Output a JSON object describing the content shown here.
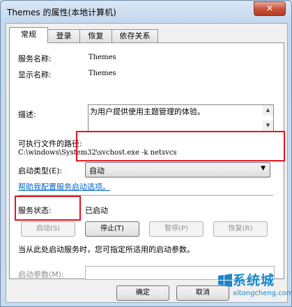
{
  "window": {
    "title": "Themes 的属性(本地计算机)",
    "close_symbol": "✕"
  },
  "tabs": [
    {
      "label": "常规",
      "active": true
    },
    {
      "label": "登录",
      "active": false
    },
    {
      "label": "恢复",
      "active": false
    },
    {
      "label": "依存关系",
      "active": false
    }
  ],
  "general": {
    "service_name_label": "服务名称:",
    "service_name": "Themes",
    "display_name_label": "显示名称:",
    "display_name": "Themes",
    "description_label": "描述:",
    "description": "为用户提供使用主题管理的体验。",
    "exe_path_label": "可执行文件的路径:",
    "exe_path": "C:\\windows\\System32\\svchost.exe -k netsvcs",
    "startup_type_label": "启动类型(E):",
    "startup_type_value": "自动",
    "help_link": "帮助我配置服务启动选项。",
    "status_label": "服务状态:",
    "status_value": "已启动",
    "buttons": {
      "start": "启动(S)",
      "stop": "停止(T)",
      "pause": "暂停(P)",
      "resume": "恢复(R)"
    },
    "hint": "当从此处启动服务时，您可指定所适用的启动参数。",
    "start_params_label": "启动参数(M):",
    "start_params_value": ""
  },
  "footer": {
    "ok_label": "确定",
    "cancel_label": "取消"
  },
  "watermark": {
    "title": "系统城",
    "url": "xitongcheng.com"
  },
  "colors": {
    "highlight": "#e2141f",
    "link": "#0066cc",
    "watermark": "#1a86c8"
  }
}
